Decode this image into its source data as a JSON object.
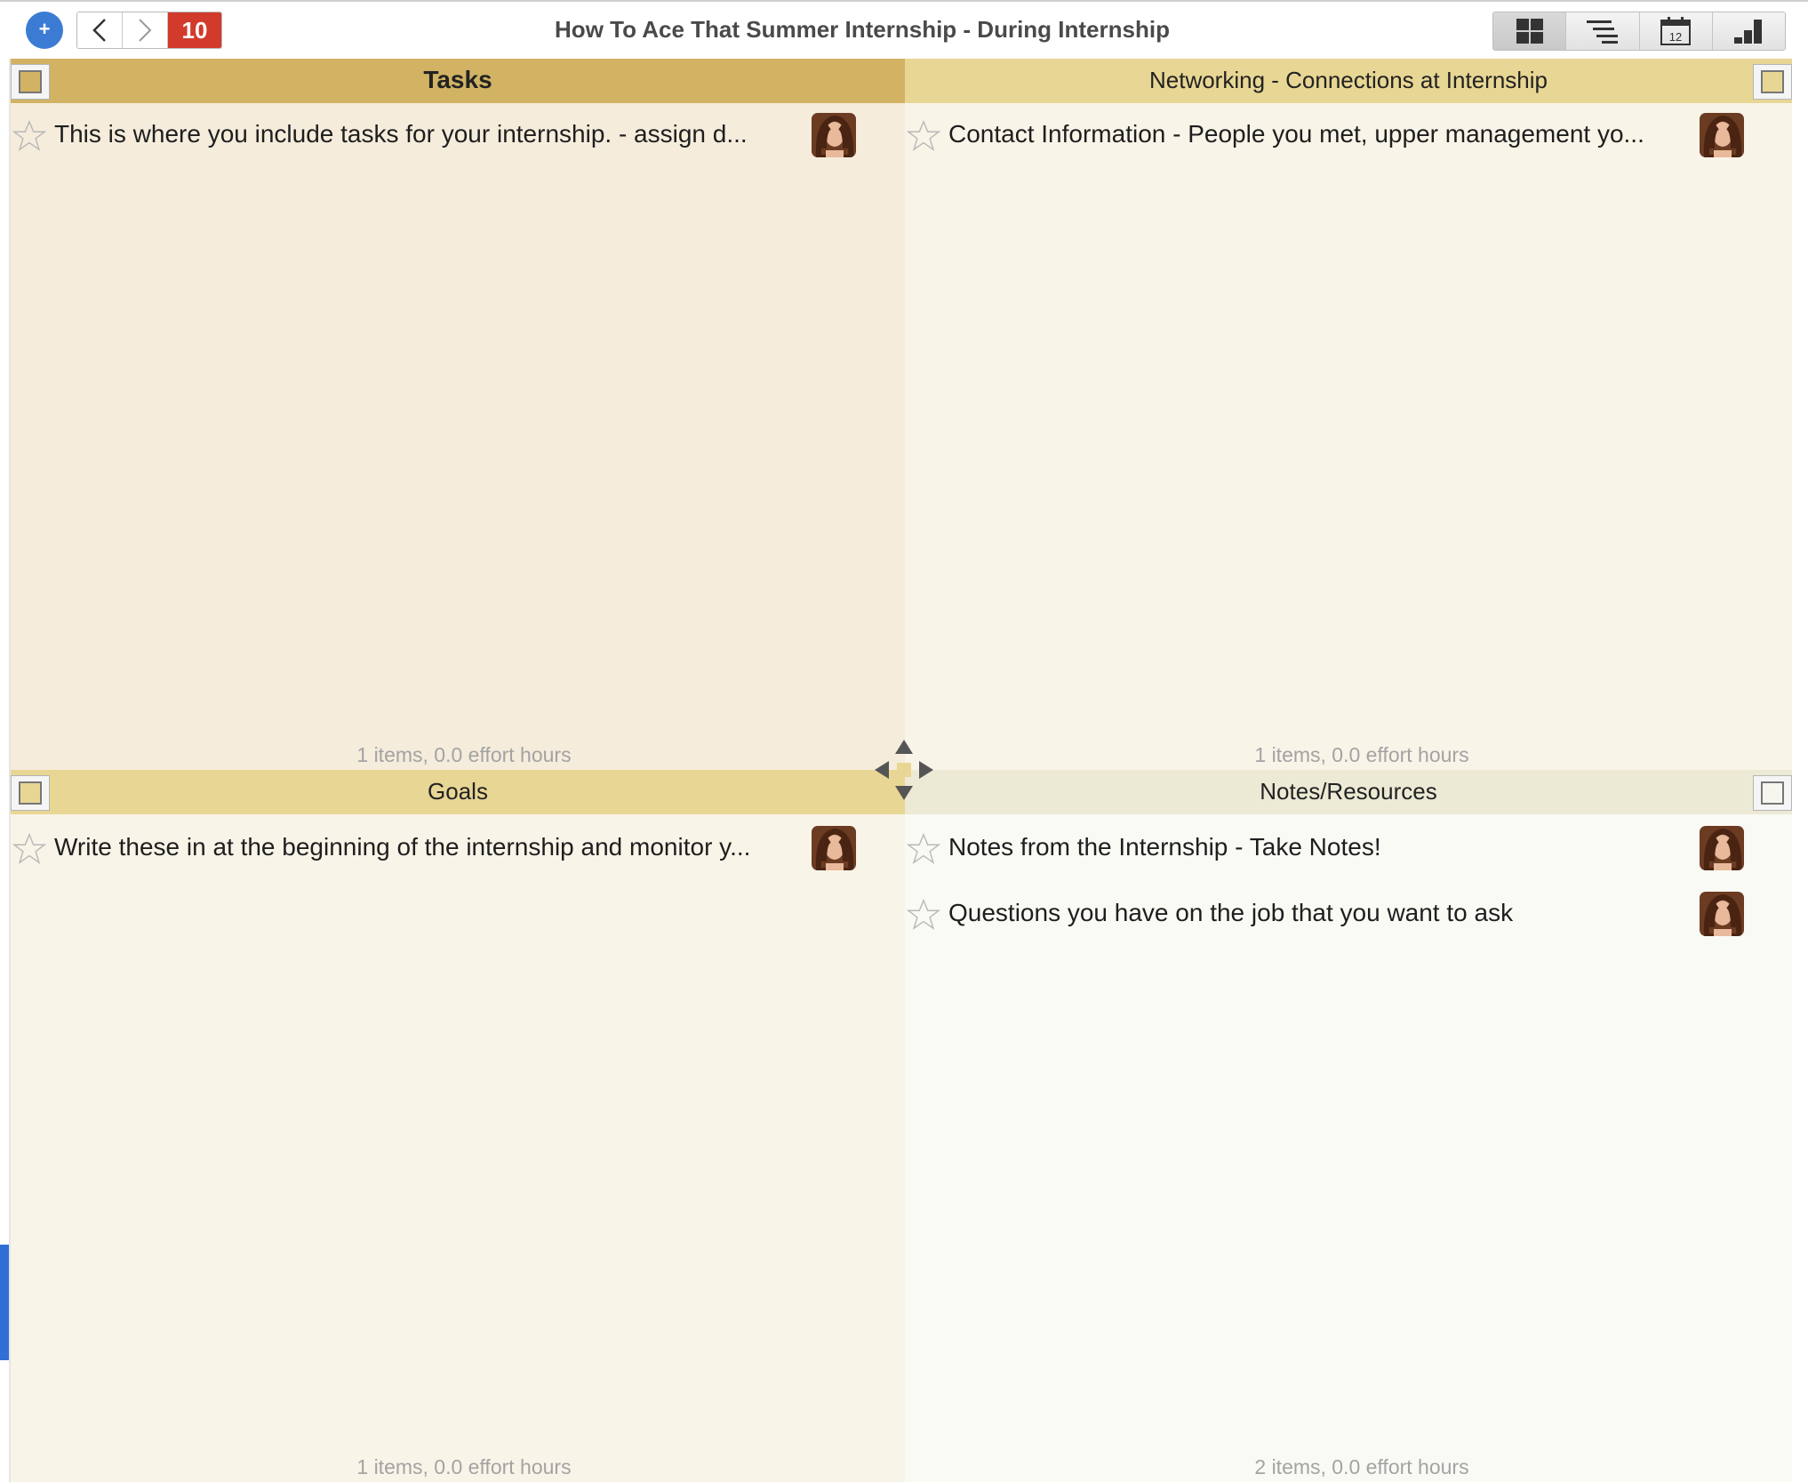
{
  "toolbar": {
    "add_label": "+",
    "badge_count": "10",
    "title": "How To Ace That Summer Internship - During Internship",
    "views": [
      "grid-view-icon",
      "list-view-icon",
      "calendar-view-icon",
      "chart-view-icon"
    ],
    "calendar_day": "12"
  },
  "quadrants": {
    "q1": {
      "title": "Tasks",
      "items": [
        {
          "text": "This is where you include tasks for your internship. - assign d..."
        }
      ],
      "footer": "1 items, 0.0 effort hours"
    },
    "q2": {
      "title": "Networking - Connections at Internship",
      "items": [
        {
          "text": "Contact Information - People you met, upper management yo..."
        }
      ],
      "footer": "1 items, 0.0 effort hours"
    },
    "q3": {
      "title": "Goals",
      "items": [
        {
          "text": "Write these in at the beginning of the internship and monitor y..."
        }
      ],
      "footer": "1 items, 0.0 effort hours"
    },
    "q4": {
      "title": "Notes/Resources",
      "items": [
        {
          "text": "Notes from the Internship - Take Notes!"
        },
        {
          "text": "Questions you have on the job that you want to ask"
        }
      ],
      "footer": "2 items, 0.0 effort hours"
    }
  },
  "colors": {
    "tasks_header": "#d2b364",
    "networking_header": "#e8d694",
    "goals_header": "#e8d694",
    "notes_header": "#ecead5",
    "badge": "#d23a2b",
    "add_button": "#3b7bd4"
  }
}
